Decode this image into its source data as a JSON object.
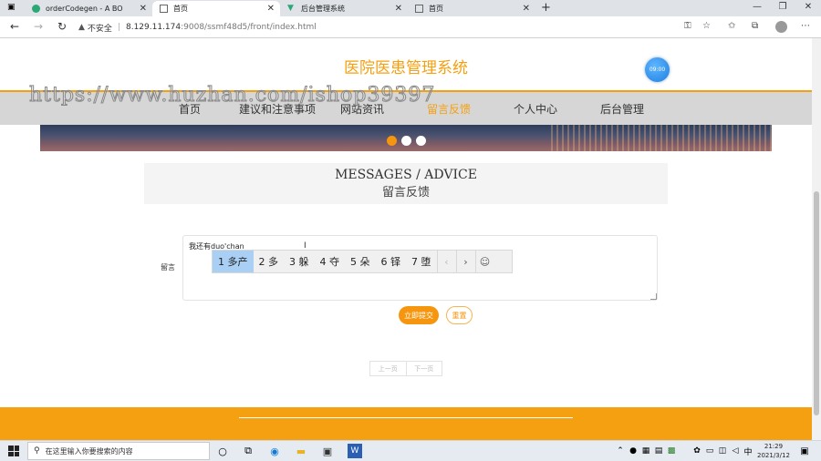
{
  "browser": {
    "tabs": [
      {
        "title": "orderCodegen - A BO",
        "active": false
      },
      {
        "title": "首页",
        "active": true
      },
      {
        "title": "后台管理系统",
        "active": false
      },
      {
        "title": "首页",
        "active": false
      }
    ],
    "security_label": "不安全",
    "url_host": "8.129.11.174",
    "url_rest": ":9008/ssmf48d5/front/index.html"
  },
  "site": {
    "title": "医院医患管理系统",
    "clock": "09:00",
    "watermark": "https://www.huzhan.com/ishop39397",
    "nav": [
      {
        "label": "首页",
        "active": false
      },
      {
        "label": "建议和注意事项",
        "active": false
      },
      {
        "label": "网站资讯",
        "active": false
      },
      {
        "label": "留言反馈",
        "active": true
      },
      {
        "label": "个人中心",
        "active": false
      },
      {
        "label": "后台管理",
        "active": false
      }
    ],
    "carousel_active_index": 0
  },
  "messages": {
    "heading_en": "MESSAGES / ADVICE",
    "heading_cn": "留言反馈",
    "label": "留言",
    "value": "我还有duo'chan",
    "submit_label": "立即提交",
    "reset_label": "重置"
  },
  "ime": {
    "candidates": [
      "1 多产",
      "2 多",
      "3 躲",
      "4 夺",
      "5 朵",
      "6 铎",
      "7 堕"
    ],
    "selected_index": 0,
    "emoji_icon": "☺"
  },
  "pager": {
    "prev": "上一页",
    "next": "下一页"
  },
  "taskbar": {
    "search_placeholder": "在这里输入你要搜索的内容",
    "time": "21:29",
    "date": "2021/3/12",
    "ime_indicator": "中"
  },
  "colors": {
    "accent": "#f5a011",
    "button": "#f5960e"
  }
}
